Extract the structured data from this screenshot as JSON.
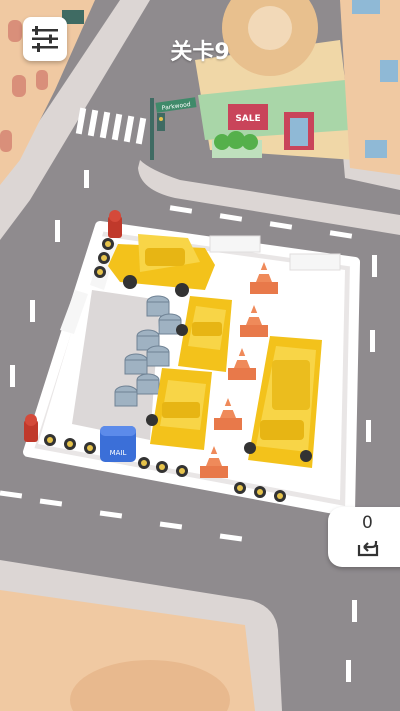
{
  "hud": {
    "level_label": "关卡9",
    "undo_count": "0",
    "settings_icon": "sliders-icon",
    "undo_icon": "undo-arrow-icon"
  },
  "scene": {
    "shop_sign": "SALE",
    "street_sign": "Parkwood",
    "mailbox_label": "MAIL"
  },
  "colors": {
    "road": "#8f8b8e",
    "car": "#f3c21b",
    "lot": "#ffffff",
    "cone": "#ec7a45",
    "hydrant": "#c0392b",
    "mailbox": "#3b6fd8"
  }
}
